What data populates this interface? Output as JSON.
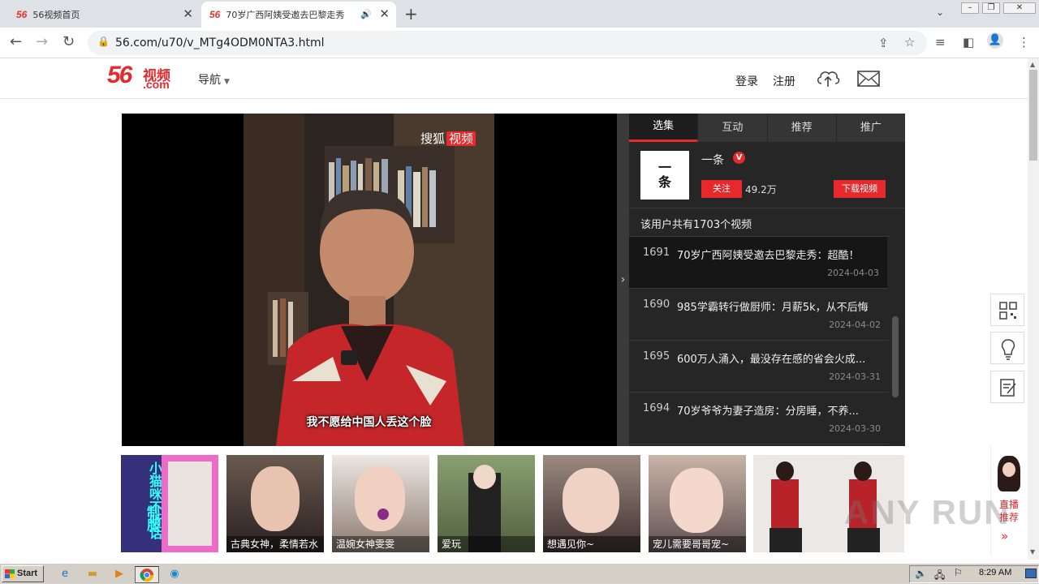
{
  "browser": {
    "tabs": [
      {
        "title": "56视频首页",
        "favicon": "56"
      },
      {
        "title": "70岁广西阿姨受邀去巴黎走秀",
        "favicon": "56"
      }
    ],
    "url": "56.com/u70/v_MTg4ODM0NTA3.html"
  },
  "header": {
    "logo_main": "56",
    "logo_sub": "视频",
    "logo_com": ".com",
    "nav_label": "导航",
    "login_label": "登录",
    "register_label": "注册"
  },
  "player": {
    "watermark_prefix": "搜狐",
    "watermark_highlight": "视频",
    "subtitle": "我不愿给中国人丢这个脸"
  },
  "panel": {
    "tabs": [
      "选集",
      "互动",
      "推荐",
      "推广"
    ],
    "avatar_text": "一条",
    "user_name": "一条",
    "verified_badge": "V",
    "follow_label": "关注",
    "fans": "49.2万",
    "download_label": "下载视频",
    "video_count_text": "该用户共有1703个视频",
    "videos": [
      {
        "num": "1691",
        "title": "70岁广西阿姨受邀去巴黎走秀：超酷！",
        "date": "2024-04-03"
      },
      {
        "num": "1690",
        "title": "985学霸转行做厨师：月薪5k，从不后悔",
        "date": "2024-04-02"
      },
      {
        "num": "1695",
        "title": "600万人涌入，最没存在感的省会火成...",
        "date": "2024-03-31"
      },
      {
        "num": "1694",
        "title": "70岁爷爷为妻子造房：分房睡，不养...",
        "date": "2024-03-30"
      }
    ]
  },
  "float_tools": [
    "qrcode-icon",
    "lightbulb-icon",
    "feedback-icon"
  ],
  "ads": [
    {
      "caption": "",
      "poster_text": "小猫咪不听话",
      "stamp": "制服"
    },
    {
      "caption": "古典女神，柔情若水"
    },
    {
      "caption": "温婉女神雯雯"
    },
    {
      "caption": "爱玩"
    },
    {
      "caption": "想遇见你~"
    },
    {
      "caption": "宠儿需要哥哥宠~"
    },
    {
      "caption": ""
    }
  ],
  "live": {
    "label_line1": "直播",
    "label_line2": "推荐",
    "arrow": "»"
  },
  "watermark": "ANY RUN",
  "taskbar": {
    "start_label": "Start",
    "clock": "8:29 AM"
  },
  "colors": {
    "brand_red": "#e8292c",
    "panel_bg": "#262626"
  }
}
